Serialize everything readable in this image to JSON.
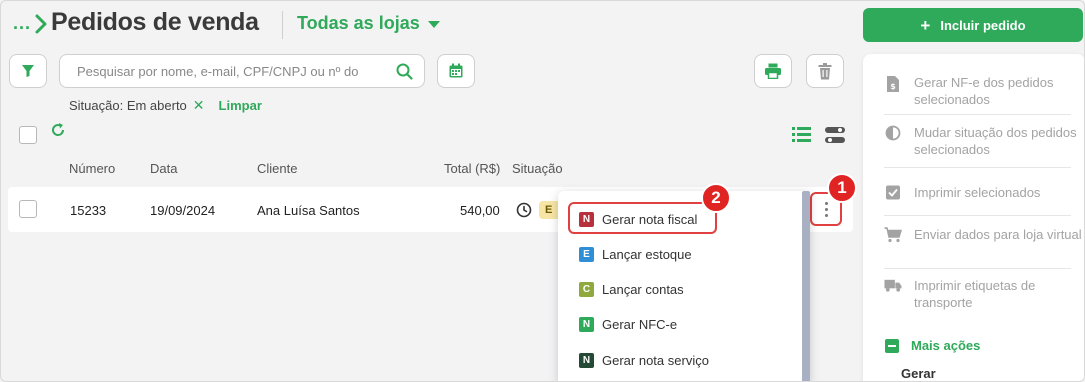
{
  "breadcrumb": {
    "dots": "...",
    "chevron": "chevron-right-icon"
  },
  "header": {
    "title": "Pedidos de venda",
    "store_selector": "Todas as lojas",
    "primary_button": {
      "icon": "+",
      "label": "Incluir pedido"
    }
  },
  "toolbar": {
    "search_placeholder": "Pesquisar por nome, e-mail, CPF/CNPJ ou nº do pedido",
    "icons": [
      "filter-icon",
      "search-icon",
      "calendar-icon",
      "print-icon",
      "trash-icon"
    ]
  },
  "filters": {
    "situation": "Situação: Em aberto",
    "remove": "✕",
    "clear": "Limpar"
  },
  "table": {
    "columns": [
      "Número",
      "Data",
      "Cliente",
      "Total (R$)",
      "Situação"
    ],
    "rows": [
      {
        "numero": "15233",
        "data": "19/09/2024",
        "cliente": "Ana Luísa Santos",
        "total": "540,00",
        "situacao_badge": "E"
      }
    ]
  },
  "markers": {
    "one": "1",
    "two": "2"
  },
  "menu": {
    "items": [
      {
        "letter": "N",
        "label": "Gerar nota fiscal",
        "color": "#b7313c"
      },
      {
        "letter": "E",
        "label": "Lançar estoque",
        "color": "#2f8fd6"
      },
      {
        "letter": "C",
        "label": "Lançar contas",
        "color": "#8fa93f"
      },
      {
        "letter": "N",
        "label": "Gerar NFC-e",
        "color": "#2fa95a"
      },
      {
        "letter": "N",
        "label": "Gerar nota serviço",
        "color": "#244a35"
      }
    ]
  },
  "panel": {
    "items": [
      {
        "label": "Gerar NF-e dos pedidos selecionados",
        "icon": "invoice-icon"
      },
      {
        "label": "Mudar situação dos pedidos selecionados",
        "icon": "half-circle-icon"
      },
      {
        "label": "Imprimir selecionados",
        "icon": "checkbox-icon"
      },
      {
        "label": "Enviar dados para loja virtual",
        "icon": "cart-icon"
      },
      {
        "label": "Imprimir etiquetas de transporte",
        "icon": "truck-icon"
      }
    ],
    "more_actions": "Mais ações",
    "section_gerar": "Gerar"
  },
  "colors": {
    "accent": "#2fa95a",
    "marker": "#e02424",
    "highlight": "#e04040"
  }
}
